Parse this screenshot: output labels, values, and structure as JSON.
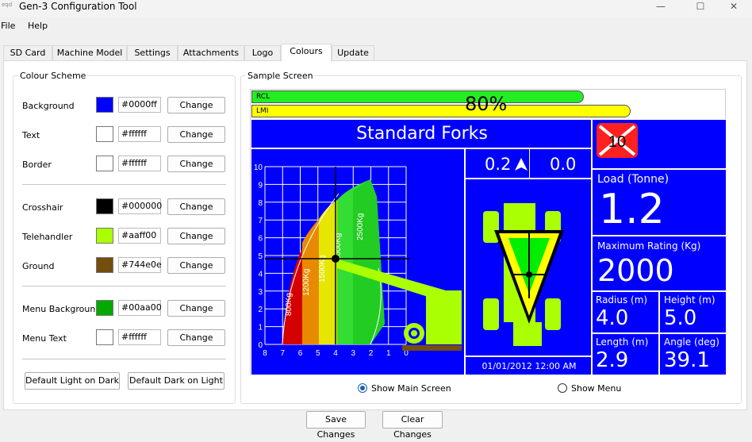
{
  "window": {
    "icon": "eqd",
    "title": "Gen-3 Configuration Tool",
    "minimize": "—",
    "maximize": "☐",
    "close": "✕"
  },
  "menu": [
    "File",
    "Help"
  ],
  "tabs": [
    "SD Card",
    "Machine Model",
    "Settings",
    "Attachments",
    "Logo",
    "Colours",
    "Update"
  ],
  "colour_scheme": {
    "legend": "Colour Scheme",
    "change_label": "Change",
    "rows": [
      {
        "label": "Background",
        "hex": "#0000ff",
        "color": "#0000ff"
      },
      {
        "label": "Text",
        "hex": "#ffffff",
        "color": "#ffffff"
      },
      {
        "label": "Border",
        "hex": "#ffffff",
        "color": "#ffffff"
      },
      {
        "label": "Crosshair",
        "hex": "#000000",
        "color": "#000000"
      },
      {
        "label": "Telehandler",
        "hex": "#aaff00",
        "color": "#aaff00"
      },
      {
        "label": "Ground",
        "hex": "#744e0e",
        "color": "#744e0e"
      },
      {
        "label": "Menu Background",
        "hex": "#00aa00",
        "color": "#00aa00"
      },
      {
        "label": "Menu Text",
        "hex": "#ffffff",
        "color": "#ffffff"
      }
    ],
    "default_light": "Default Light on Dark",
    "default_dark": "Default Dark on Light"
  },
  "sample": {
    "legend": "Sample Screen",
    "rcl_label": "RCL",
    "lmi_label": "LMI",
    "percent": "80%",
    "attachment": "Standard Forks",
    "angle": "0.2",
    "angle_icon": "arrow-up-icon",
    "extension": "0.0",
    "datetime": "01/01/2012 12:00 AM",
    "x_ticks": [
      "8",
      "7",
      "6",
      "5",
      "4",
      "3",
      "2",
      "1",
      "0"
    ],
    "y_ticks": [
      "10",
      "9",
      "8",
      "7",
      "6",
      "5",
      "4",
      "3",
      "2",
      "1",
      "0"
    ],
    "zones": [
      {
        "label": "800Kg",
        "color": "#d40000"
      },
      {
        "label": "1200Kg",
        "color": "#e88a00"
      },
      {
        "label": "1500Kg",
        "color": "#e6e600"
      },
      {
        "label": "2000Kg",
        "color": "#33dd33"
      },
      {
        "label": "2500Kg",
        "color": "#22cc22"
      }
    ],
    "stop_sign": "10",
    "load_label": "Load (Tonne)",
    "load_value": "1.2",
    "max_label": "Maximum Rating (Kg)",
    "max_value": "2000",
    "radius_label": "Radius (m)",
    "radius_value": "4.0",
    "height_label": "Height (m)",
    "height_value": "5.0",
    "length_label": "Length (m)",
    "length_value": "2.9",
    "angle_label": "Angle (deg)",
    "angle_value": "39.1",
    "rcl_fraction": 0.7,
    "lmi_fraction": 0.8
  },
  "radios": {
    "main": "Show Main Screen",
    "menu": "Show Menu",
    "selected": "main"
  },
  "footer": {
    "save": "Save Changes",
    "clear": "Clear Changes"
  }
}
